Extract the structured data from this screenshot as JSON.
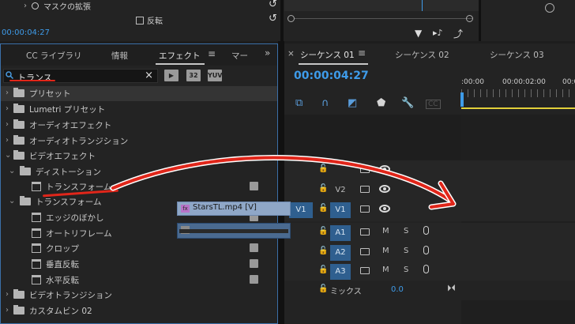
{
  "top": {
    "mask_expansion_label": "マスクの拡張",
    "flip_label": "反転",
    "timecode": "00:00:04:27"
  },
  "effects_panel": {
    "tabs": [
      "CC ライブラリ",
      "情報",
      "エフェクト",
      "マー"
    ],
    "menu_icon": "hamburger-icon",
    "overflow_icon": "double-chevron-right-icon",
    "search": {
      "value": "トランス",
      "clear_icon": "close-icon"
    },
    "filter_buttons": [
      "",
      "32",
      "YUV"
    ],
    "tree": [
      {
        "label": "プリセット",
        "level": 0,
        "type": "folder"
      },
      {
        "label": "Lumetri プリセット",
        "level": 0,
        "type": "folder"
      },
      {
        "label": "オーディオエフェクト",
        "level": 0,
        "type": "folder"
      },
      {
        "label": "オーディオトランジション",
        "level": 0,
        "type": "folder"
      },
      {
        "label": "ビデオエフェクト",
        "level": 0,
        "type": "folder",
        "expanded": true
      },
      {
        "label": "ディストーション",
        "level": 1,
        "type": "folder",
        "expanded": true
      },
      {
        "label": "トランスフォーム",
        "level": 2,
        "type": "effect"
      },
      {
        "label": "トランスフォーム",
        "level": 1,
        "type": "folder",
        "expanded": true
      },
      {
        "label": "エッジのぼかし",
        "level": 2,
        "type": "effect"
      },
      {
        "label": "オートリフレーム",
        "level": 2,
        "type": "effect"
      },
      {
        "label": "クロップ",
        "level": 2,
        "type": "effect"
      },
      {
        "label": "垂直反転",
        "level": 2,
        "type": "effect"
      },
      {
        "label": "水平反転",
        "level": 2,
        "type": "effect"
      },
      {
        "label": "ビデオトランジション",
        "level": 0,
        "type": "folder"
      },
      {
        "label": "カスタムビン 02",
        "level": 0,
        "type": "folder"
      }
    ]
  },
  "timeline": {
    "close_icon": "×",
    "tabs": [
      "シーケンス 01",
      "シーケンス 02",
      "シーケンス 03"
    ],
    "timecode": "00:00:04:27",
    "ruler": [
      ":00:00",
      "00:00:02:00",
      "00:0"
    ],
    "tracks": {
      "src_v": "V1",
      "video": [
        "V3",
        "V2",
        "V1"
      ],
      "audio": [
        "A1",
        "A2",
        "A3"
      ],
      "mute": "M",
      "solo": "S",
      "mix_label": "ミックス",
      "mix_value": "0.0"
    },
    "clip_video_name": "StarsTL.mp4 [V]",
    "clip_fx": "fx"
  }
}
